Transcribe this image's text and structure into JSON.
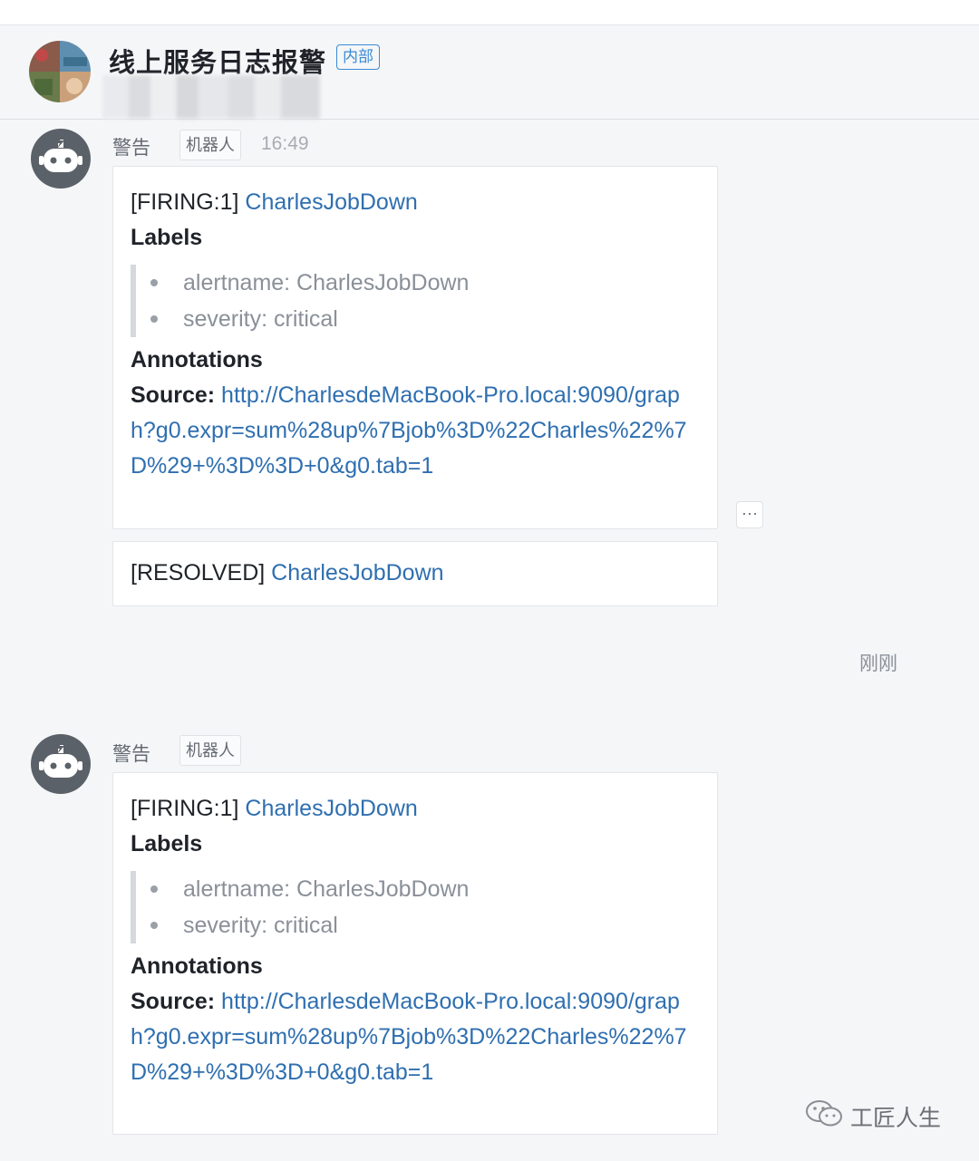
{
  "header": {
    "group_name": "线上服务日志报警",
    "tag": "内部"
  },
  "messages": [
    {
      "sender": "警告",
      "bot_tag": "机器人",
      "time": "16:49",
      "cards": [
        {
          "status": "[FIRING:1]",
          "alert_name": "CharlesJobDown",
          "labels_title": "Labels",
          "labels": [
            "alertname: CharlesJobDown",
            "severity: critical"
          ],
          "annotations_title": "Annotations",
          "source_label": "Source:",
          "source_url": "http://CharlesdeMacBook-Pro.local:9090/graph?g0.expr=sum%28up%7Bjob%3D%22Charles%22%7D%29+%3D%3D+0&g0.tab=1"
        },
        {
          "status": "[RESOLVED]",
          "alert_name": "CharlesJobDown"
        }
      ],
      "more_label": "···"
    },
    {
      "sender": "警告",
      "bot_tag": "机器人",
      "cards": [
        {
          "status": "[FIRING:1]",
          "alert_name": "CharlesJobDown",
          "labels_title": "Labels",
          "labels": [
            "alertname: CharlesJobDown",
            "severity: critical"
          ],
          "annotations_title": "Annotations",
          "source_label": "Source:",
          "source_url": "http://CharlesdeMacBook-Pro.local:9090/graph?g0.expr=sum%28up%7Bjob%3D%22Charles%22%7D%29+%3D%3D+0&g0.tab=1"
        }
      ]
    }
  ],
  "read_status": "刚刚",
  "watermark": "工匠人生",
  "icons": {
    "bot_avatar": "robot-icon",
    "watermark_icon": "wechat-icon"
  }
}
